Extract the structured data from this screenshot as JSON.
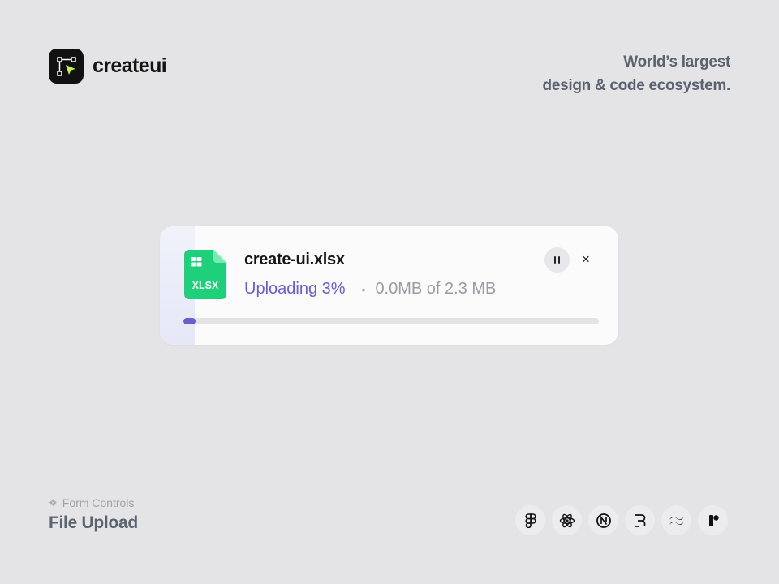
{
  "brand": {
    "name": "createui",
    "logo_icon": "cursor-bezier-icon"
  },
  "tagline": {
    "line1": "World’s largest",
    "line2": "design & code ecosystem."
  },
  "upload": {
    "file_name": "create-ui.xlsx",
    "file_type_label": "XLSX",
    "file_icon": "spreadsheet-file-icon",
    "status": "Uploading 3%",
    "bullet": "•",
    "size": "0.0MB of 2.3 MB",
    "progress": 0.03,
    "pause_icon": "pause-icon",
    "close_label": "×",
    "colors": {
      "accent": "#6a5ecf",
      "file_green": "#1fd07a"
    }
  },
  "footer": {
    "category_icon": "❖",
    "category": "Form Controls",
    "component": "File Upload",
    "tech_icons": [
      "figma-icon",
      "react-icon",
      "nextjs-icon",
      "remix-icon",
      "tailwind-icon",
      "framer-icon"
    ]
  }
}
